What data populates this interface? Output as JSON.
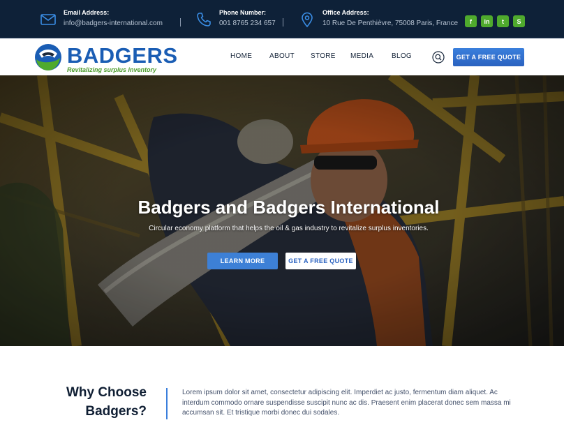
{
  "topbar": {
    "email": {
      "label": "Email Address:",
      "value": "info@badgers-international.com",
      "icon": "envelope-icon"
    },
    "phone": {
      "label": "Phone Number:",
      "value": "001 8765 234 657",
      "icon": "phone-icon"
    },
    "office": {
      "label": "Office Address:",
      "value": "10 Rue De Penthièvre, 75008 Paris, France",
      "icon": "map-pin-icon"
    },
    "socials": [
      {
        "name": "facebook",
        "glyph": "f"
      },
      {
        "name": "linkedin",
        "glyph": "in"
      },
      {
        "name": "twitter",
        "glyph": "t"
      },
      {
        "name": "skype",
        "glyph": "S"
      }
    ]
  },
  "brand": {
    "name": "BADGERS",
    "tagline": "Revitalizing surplus inventory",
    "colors": {
      "primary": "#1a5db4",
      "green": "#4faa2d"
    }
  },
  "nav": {
    "items": [
      "HOME",
      "ABOUT",
      "STORE",
      "MEDIA",
      "BLOG"
    ],
    "search_icon": "search-icon",
    "cta": "GET A FREE QUOTE"
  },
  "hero": {
    "title": "Badgers and Badgers International",
    "subtitle": "Circular economy platform that helps the oil & gas industry to revitalize surplus inventories.",
    "primary_button": "LEARN MORE",
    "secondary_button": "GET A FREE QUOTE"
  },
  "why": {
    "title_line1": "Why Choose",
    "title_line2": "Badgers?",
    "body": "Lorem ipsum dolor sit amet, consectetur adipiscing elit. Imperdiet ac justo, fermentum diam aliquet. Ac interdum commodo ornare suspendisse suscipit nunc ac dis. Praesent enim placerat donec sem massa mi accumsan sit. Et tristique morbi donec dui sodales."
  },
  "colors": {
    "topbar_bg": "#0e2138",
    "accent": "#3a7fdc"
  }
}
